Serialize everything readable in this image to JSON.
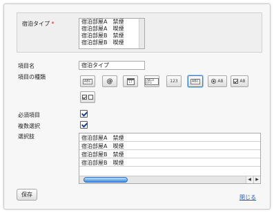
{
  "preview": {
    "field_label": "宿泊タイプ",
    "required_mark": "*",
    "options": [
      "宿泊部屋A　禁煙",
      "宿泊部屋A　喫煙",
      "宿泊部屋B　禁煙",
      "宿泊部屋B　喫煙"
    ]
  },
  "form": {
    "name_label": "項目名",
    "name_value": "宿泊タイプ",
    "type_label": "項目の種類",
    "required_label": "必須項目",
    "required_checked": true,
    "multiple_label": "複数選択",
    "multiple_checked": true,
    "choices_label": "選択肢",
    "choices": [
      "宿泊部屋A　禁煙",
      "宿泊部屋A　喫煙",
      "宿泊部屋B　禁煙",
      "宿泊部屋B　喫煙"
    ]
  },
  "type_buttons": [
    {
      "name": "text-field-type-icon",
      "text": "ABC"
    },
    {
      "name": "email-type-icon",
      "text": "@"
    },
    {
      "name": "date-type-icon",
      "text": "17"
    },
    {
      "name": "textarea-type-icon",
      "text": "ABCD EFG"
    },
    {
      "name": "number-type-icon",
      "text": "123"
    },
    {
      "name": "select-list-type-icon",
      "text": "ABC",
      "selected": true
    },
    {
      "name": "radio-type-icon",
      "text": "AB"
    },
    {
      "name": "checkbox-type-icon",
      "text": "AB"
    },
    {
      "name": "checkbox-group-type-icon",
      "text": ""
    }
  ],
  "footer": {
    "save_label": "保存",
    "close_label": "閉じる"
  },
  "colors": {
    "accent": "#3f7fd4",
    "link": "#1a5fc0",
    "required": "#d02020"
  }
}
